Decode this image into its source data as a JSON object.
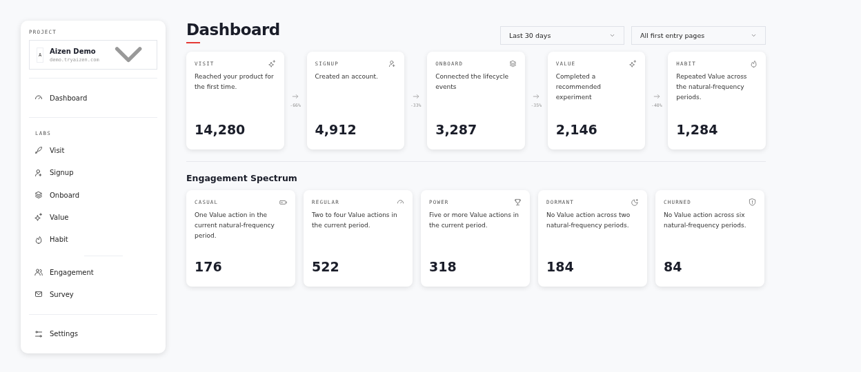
{
  "sidebar": {
    "project_label": "PROJECT",
    "project": {
      "avatar": "A",
      "name": "Aizen Demo",
      "domain": "demo.tryaizen.com"
    },
    "top_items": [
      {
        "label": "Dashboard"
      }
    ],
    "section_label": "LABS",
    "lab_items": [
      {
        "label": "Visit"
      },
      {
        "label": "Signup"
      },
      {
        "label": "Onboard"
      },
      {
        "label": "Value"
      },
      {
        "label": "Habit"
      }
    ],
    "other_items": [
      {
        "label": "Engagement"
      },
      {
        "label": "Survey"
      }
    ],
    "bottom_items": [
      {
        "label": "Settings"
      }
    ]
  },
  "page": {
    "title": "Dashboard",
    "filters": [
      {
        "value": "Last 30 days"
      },
      {
        "value": "All first entry pages"
      }
    ]
  },
  "funnel": [
    {
      "label": "VISIT",
      "description": "Reached your product for the first time.",
      "value": "14,280"
    },
    {
      "drop": "-66%",
      "label": "SIGNUP",
      "description": "Created an account.",
      "value": "4,912"
    },
    {
      "drop": "-33%",
      "label": "ONBOARD",
      "description": "Connected the lifecycle events",
      "value": "3,287"
    },
    {
      "drop": "-35%",
      "label": "VALUE",
      "description": "Completed a recommended experiment",
      "value": "2,146"
    },
    {
      "drop": "-40%",
      "label": "HABIT",
      "description": "Repeated Value across the natural-frequency periods.",
      "value": "1,284"
    }
  ],
  "engagement": {
    "title": "Engagement Spectrum",
    "cards": [
      {
        "label": "CASUAL",
        "description": "One Value action in the current natural-frequency period.",
        "value": "176"
      },
      {
        "label": "REGULAR",
        "description": "Two to four Value actions in the current period.",
        "value": "522"
      },
      {
        "label": "POWER",
        "description": "Five or more Value actions in the current period.",
        "value": "318"
      },
      {
        "label": "DORMANT",
        "description": "No Value action across two natural-frequency periods.",
        "value": "184"
      },
      {
        "label": "CHURNED",
        "description": "No Value action across six natural-frequency periods.",
        "value": "84"
      }
    ]
  }
}
